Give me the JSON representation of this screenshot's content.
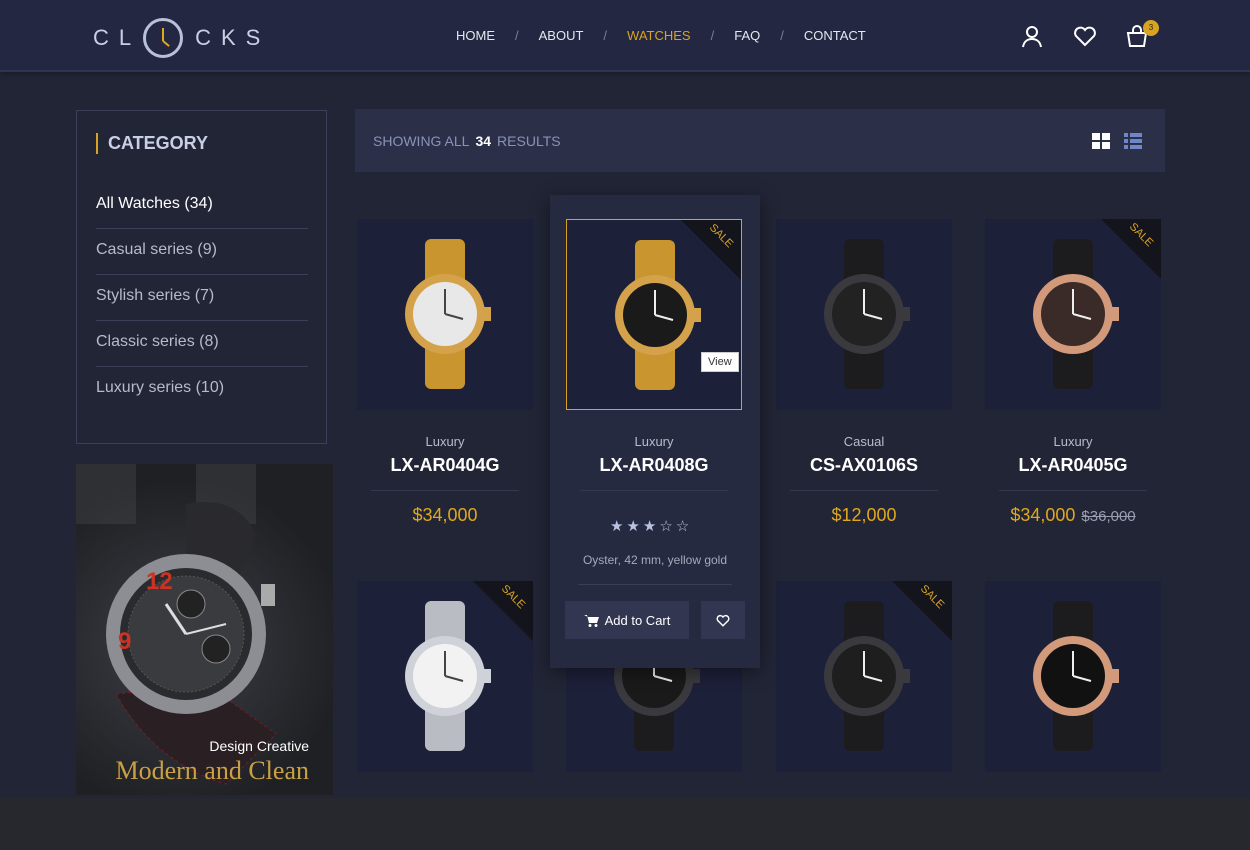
{
  "header": {
    "logo": "CLOCKS",
    "logo_parts": [
      "CL",
      "CKS"
    ],
    "nav": [
      {
        "label": "HOME",
        "active": false
      },
      {
        "label": "ABOUT",
        "active": false
      },
      {
        "label": "WATCHES",
        "active": true
      },
      {
        "label": "FAQ",
        "active": false
      },
      {
        "label": "CONTACT",
        "active": false
      }
    ],
    "nav_separator": "/",
    "cart_count": "3",
    "icons": [
      "user-icon",
      "heart-icon",
      "shopping-bag-icon"
    ]
  },
  "sidebar": {
    "title": "CATEGORY",
    "items": [
      {
        "label": "All Watches (34)",
        "selected": true
      },
      {
        "label": "Casual series (9)"
      },
      {
        "label": "Stylish series (7)"
      },
      {
        "label": "Classic series (8)"
      },
      {
        "label": "Luxury series (10)"
      }
    ]
  },
  "banner": {
    "line1": "Design Creative",
    "line2": "Modern and Clean"
  },
  "toolbar": {
    "showing_prefix": "SHOWING ALL",
    "count": "34",
    "showing_suffix": "RESULTS",
    "views": [
      "grid-view-icon",
      "list-view-icon"
    ]
  },
  "colors": {
    "accent": "#d9a322",
    "background": "#222536",
    "card": "#1d2039"
  },
  "products": [
    {
      "type": "Luxury",
      "name": "LX-AR0404G",
      "price": "$34,000",
      "old_price": "",
      "sale": false,
      "band": "gold",
      "dial": "#e8e8e8"
    },
    {
      "type": "Luxury",
      "name": "LX-AR0408G",
      "price": "",
      "old_price": "",
      "sale": true,
      "band": "gold",
      "dial": "#1a1a1a",
      "hovered": true,
      "rating": 3,
      "max_rating": 5,
      "desc": "Oyster, 42 mm, yellow gold",
      "add_to_cart": "Add to Cart",
      "view": "View"
    },
    {
      "type": "Casual",
      "name": "CS-AX0106S",
      "price": "$12,000",
      "old_price": "",
      "sale": false,
      "band": "black",
      "dial": "#222"
    },
    {
      "type": "Luxury",
      "name": "LX-AR0405G",
      "price": "$34,000",
      "old_price": "$36,000",
      "sale": true,
      "band": "black",
      "dial": "#3a2a28"
    },
    {
      "sale": true,
      "band": "silver",
      "dial": "#f2f2f2"
    },
    {
      "sale": false,
      "band": "black",
      "dial": "#1a1a1a"
    },
    {
      "sale": true,
      "band": "black",
      "dial": "#1e1e1e"
    },
    {
      "sale": false,
      "band": "black",
      "dial": "#111"
    }
  ],
  "sale_label": "SALE"
}
